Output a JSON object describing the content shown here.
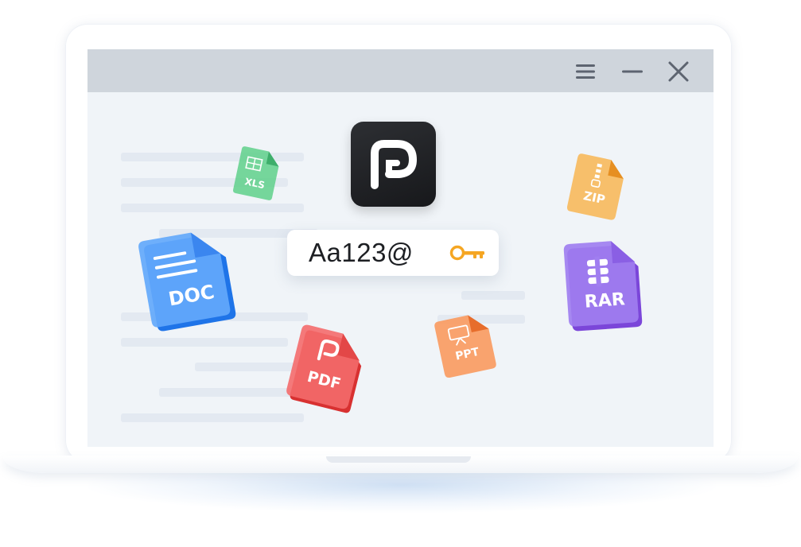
{
  "window": {
    "menu_icon": "menu-icon",
    "minimize_icon": "minimize-icon",
    "close_icon": "close-icon"
  },
  "app_logo": {
    "icon": "p-logo-icon",
    "color": "#1c1d20"
  },
  "password": {
    "value": "Aa123@",
    "icon": "key-icon",
    "icon_color": "#f5a623"
  },
  "files": [
    {
      "label": "XLS",
      "color": "#4cc37a"
    },
    {
      "label": "ZIP",
      "color": "#f6a53b"
    },
    {
      "label": "DOC",
      "color": "#3e8ff5"
    },
    {
      "label": "RAR",
      "color": "#8f63e6"
    },
    {
      "label": "PDF",
      "color": "#ef4a4a"
    },
    {
      "label": "PPT",
      "color": "#f3834a"
    }
  ]
}
